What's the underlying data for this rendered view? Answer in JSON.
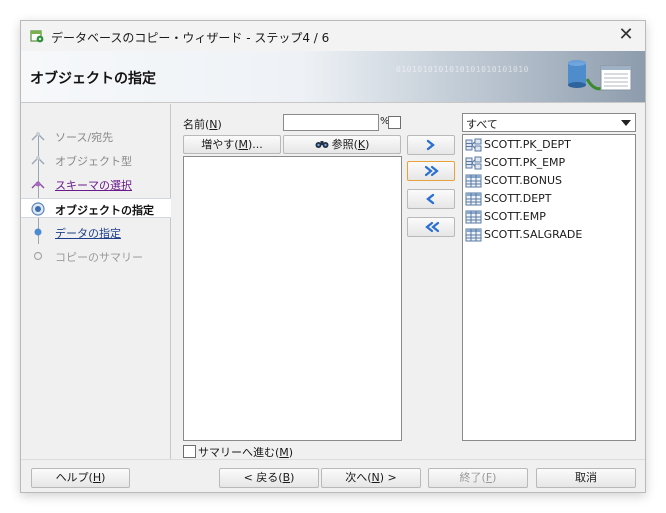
{
  "window": {
    "title": "データベースのコピー・ウィザード - ステップ4 / 6"
  },
  "header": {
    "title": "オブジェクトの指定",
    "binary_decoration": "0101010101010101010101010"
  },
  "steps": [
    {
      "label": "ソース/宛先",
      "state": "done"
    },
    {
      "label": "オブジェクト型",
      "state": "done"
    },
    {
      "label": "スキーマの選択",
      "state": "visited"
    },
    {
      "label": "オブジェクトの指定",
      "state": "current"
    },
    {
      "label": "データの指定",
      "state": "future"
    },
    {
      "label": "コピーのサマリー",
      "state": "disabled"
    }
  ],
  "filter": {
    "name_label": "名前(",
    "name_mnemonic": "N",
    "name_label_end": ")",
    "name_value": "",
    "wildcard": "%",
    "more_label": "増やす(",
    "more_mnemonic": "M",
    "more_label_end": ")...",
    "browse_label": "参照(",
    "browse_mnemonic": "K",
    "browse_label_end": ")"
  },
  "object_type_filter": {
    "selected": "すべて"
  },
  "selected_objects": [
    {
      "name": "SCOTT.PK_DEPT",
      "icon": "index-icon"
    },
    {
      "name": "SCOTT.PK_EMP",
      "icon": "index-icon"
    },
    {
      "name": "SCOTT.BONUS",
      "icon": "table-icon"
    },
    {
      "name": "SCOTT.DEPT",
      "icon": "table-icon"
    },
    {
      "name": "SCOTT.EMP",
      "icon": "table-icon"
    },
    {
      "name": "SCOTT.SALGRADE",
      "icon": "table-icon"
    }
  ],
  "proceed_to_summary": {
    "label": "サマリーへ進む(",
    "mnemonic": "M",
    "label_end": ")",
    "checked": false
  },
  "buttons": {
    "help": {
      "label": "ヘルプ(",
      "mnemonic": "H",
      "label_end": ")"
    },
    "back": {
      "label": "< 戻る(",
      "mnemonic": "B",
      "label_end": ")"
    },
    "next": {
      "label": "次へ(",
      "mnemonic": "N",
      "label_end": ") >"
    },
    "finish": {
      "label": "終了(",
      "mnemonic": "F",
      "label_end": ")"
    },
    "cancel": {
      "label": "取消"
    }
  },
  "colors": {
    "accent_arrow": "#2a6fd1",
    "link": "#1e3f8a",
    "visited_link": "#6a1b8a",
    "focus_border": "#e6a23c"
  }
}
